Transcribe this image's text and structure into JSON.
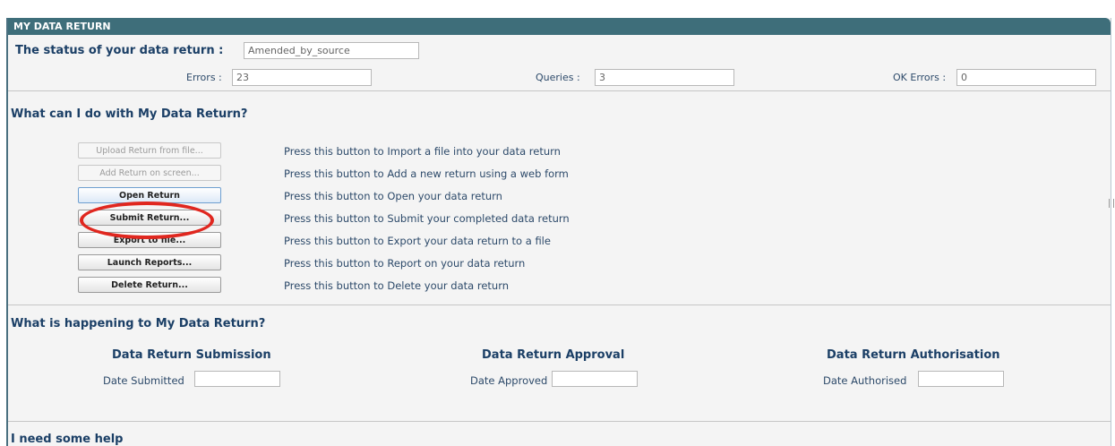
{
  "panel": {
    "title": "MY DATA RETURN"
  },
  "status": {
    "label": "The status of your data return :",
    "value": "Amended_by_source",
    "errors_label": "Errors :",
    "errors_value": "23",
    "queries_label": "Queries :",
    "queries_value": "3",
    "ok_errors_label": "OK Errors :",
    "ok_errors_value": "0"
  },
  "actions": {
    "heading": "What can I do with My Data Return?",
    "items": [
      {
        "button": "Upload Return from file...",
        "desc": "Press this button to Import a file into your data return",
        "enabled": false
      },
      {
        "button": "Add Return on screen...",
        "desc": "Press this button to Add a new return using a web form",
        "enabled": false
      },
      {
        "button": "Open Return",
        "desc": "Press this button to Open your data return",
        "enabled": true
      },
      {
        "button": "Submit Return...",
        "desc": "Press this button to Submit your completed data return",
        "enabled": true
      },
      {
        "button": "Export to file...",
        "desc": "Press this button to Export your data return to a file",
        "enabled": true
      },
      {
        "button": "Launch Reports...",
        "desc": "Press this button to Report on your data return",
        "enabled": true
      },
      {
        "button": "Delete Return...",
        "desc": "Press this button to Delete your data return",
        "enabled": true
      }
    ]
  },
  "progress": {
    "heading": "What is happening to My Data Return?",
    "submission": {
      "title": "Data Return Submission",
      "label": "Date Submitted",
      "value": ""
    },
    "approval": {
      "title": "Data Return Approval",
      "label": "Date Approved",
      "value": ""
    },
    "authorisation": {
      "title": "Data Return Authorisation",
      "label": "Date Authorised",
      "value": ""
    }
  },
  "help": {
    "heading": "I need some help"
  },
  "colors": {
    "title_bar": "#3e6e7a",
    "highlight_circle": "#e0271f"
  }
}
